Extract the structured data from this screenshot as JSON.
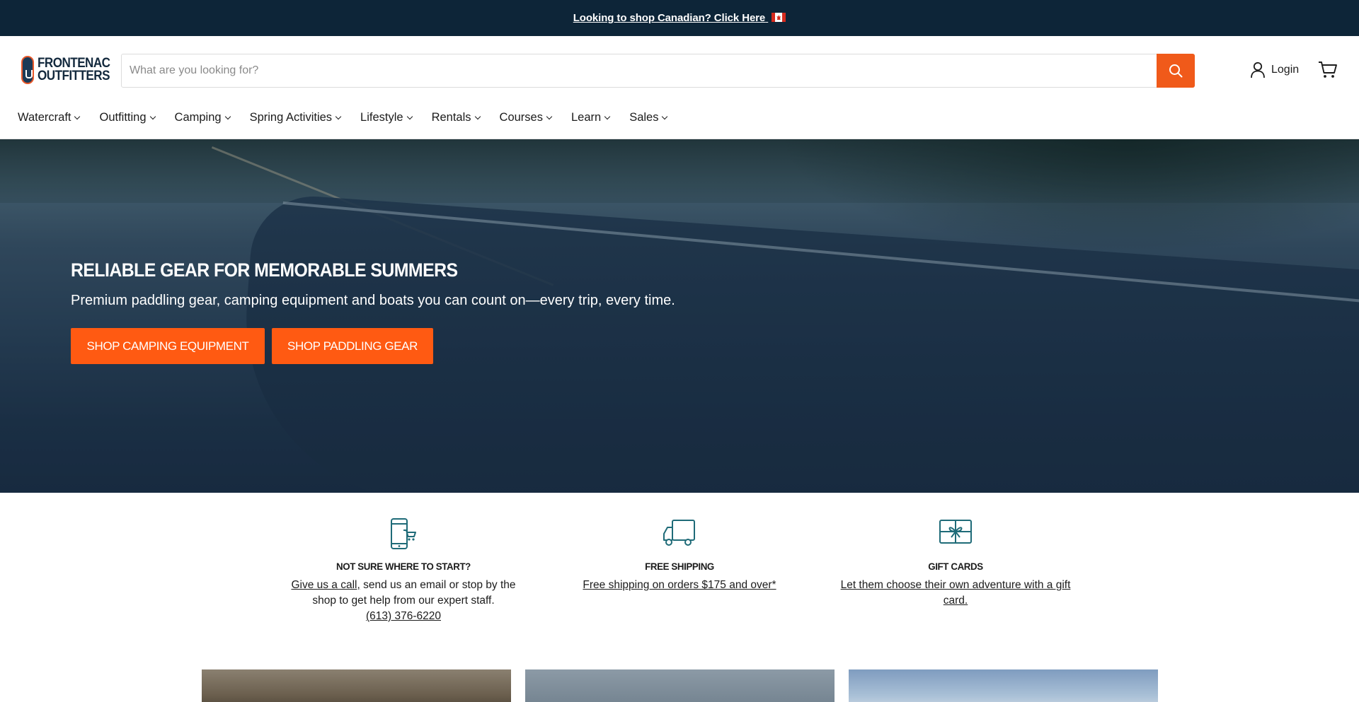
{
  "announcement": {
    "text": "Looking to shop Canadian? Click Here"
  },
  "header": {
    "logo": {
      "line1": "FRONTENAC",
      "line2": "OUTFITTERS"
    },
    "search": {
      "placeholder": "What are you looking for?",
      "value": ""
    },
    "login_label": "Login",
    "icons": {
      "search": "search-icon",
      "account": "user-icon",
      "cart": "cart-icon"
    }
  },
  "nav": {
    "items": [
      {
        "label": "Watercraft"
      },
      {
        "label": "Outfitting"
      },
      {
        "label": "Camping"
      },
      {
        "label": "Spring Activities"
      },
      {
        "label": "Lifestyle"
      },
      {
        "label": "Rentals"
      },
      {
        "label": "Courses"
      },
      {
        "label": "Learn"
      },
      {
        "label": "Sales"
      }
    ]
  },
  "hero": {
    "title": "RELIABLE GEAR FOR MEMORABLE SUMMERS",
    "subtitle": "Premium paddling gear, camping equipment and boats you can count on—every trip, every time.",
    "buttons": [
      {
        "label": "SHOP CAMPING EQUIPMENT"
      },
      {
        "label": "SHOP PADDLING GEAR"
      }
    ]
  },
  "features": [
    {
      "icon": "phone-cart-icon",
      "title": "NOT SURE WHERE TO START?",
      "link": "Give us a call,",
      "text": " send us an email or stop by the shop to get help from our expert staff.",
      "phone": "(613) 376-6220"
    },
    {
      "icon": "truck-icon",
      "title": "FREE SHIPPING",
      "link": "Free shipping on orders $175 and over*"
    },
    {
      "icon": "gift-card-icon",
      "title": "GIFT CARDS",
      "link": "Let them choose their own adventure with a gift card."
    }
  ],
  "colors": {
    "topbar": "#0d2538",
    "accent": "#ff5a12",
    "icon_teal": "#1f6b78"
  }
}
